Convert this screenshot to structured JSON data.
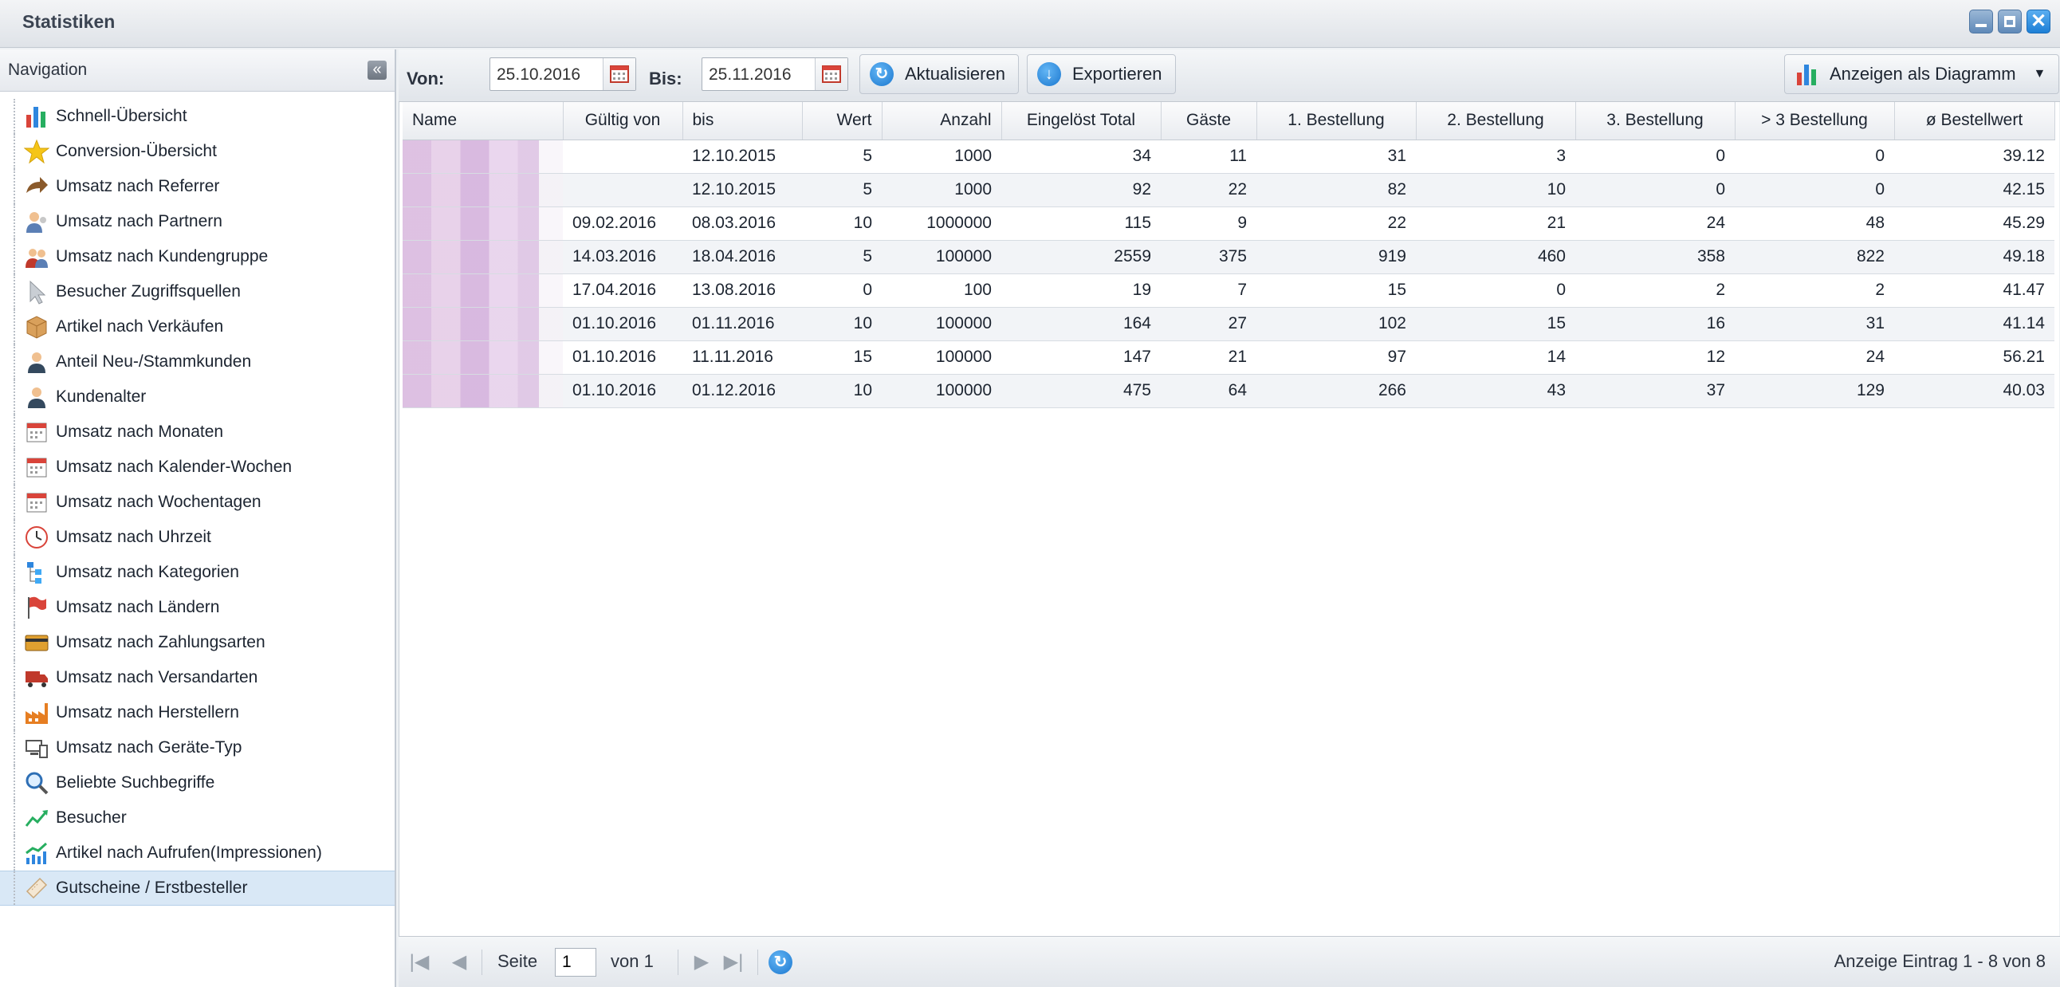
{
  "window": {
    "title": "Statistiken"
  },
  "sidebar": {
    "header": "Navigation",
    "items": [
      {
        "label": "Schnell-Übersicht",
        "icon": "bar-chart-icon"
      },
      {
        "label": "Conversion-Übersicht",
        "icon": "star-icon"
      },
      {
        "label": "Umsatz nach Referrer",
        "icon": "arrow-icon"
      },
      {
        "label": "Umsatz nach Partnern",
        "icon": "user-icon"
      },
      {
        "label": "Umsatz nach Kundengruppe",
        "icon": "users-icon"
      },
      {
        "label": "Besucher Zugriffsquellen",
        "icon": "cursor-icon"
      },
      {
        "label": "Artikel nach Verkäufen",
        "icon": "box-icon"
      },
      {
        "label": "Anteil Neu-/Stammkunden",
        "icon": "person-icon"
      },
      {
        "label": "Kundenalter",
        "icon": "person-icon"
      },
      {
        "label": "Umsatz nach Monaten",
        "icon": "calendar-icon"
      },
      {
        "label": "Umsatz nach Kalender-Wochen",
        "icon": "calendar-icon"
      },
      {
        "label": "Umsatz nach Wochentagen",
        "icon": "calendar-icon"
      },
      {
        "label": "Umsatz nach Uhrzeit",
        "icon": "clock-icon"
      },
      {
        "label": "Umsatz nach Kategorien",
        "icon": "tree-icon"
      },
      {
        "label": "Umsatz nach Ländern",
        "icon": "flag-icon"
      },
      {
        "label": "Umsatz nach Zahlungsarten",
        "icon": "card-icon"
      },
      {
        "label": "Umsatz nach Versandarten",
        "icon": "truck-icon"
      },
      {
        "label": "Umsatz nach Herstellern",
        "icon": "factory-icon"
      },
      {
        "label": "Umsatz nach Geräte-Typ",
        "icon": "devices-icon"
      },
      {
        "label": "Beliebte Suchbegriffe",
        "icon": "magnifier-icon"
      },
      {
        "label": "Besucher",
        "icon": "trend-icon"
      },
      {
        "label": "Artikel nach Aufrufen(Impressionen)",
        "icon": "trend-bars-icon"
      },
      {
        "label": "Gutscheine / Erstbesteller",
        "icon": "ticket-icon"
      }
    ],
    "selected_index": 22
  },
  "toolbar": {
    "von_label": "Von:",
    "von_value": "25.10.2016",
    "bis_label": "Bis:",
    "bis_value": "25.11.2016",
    "refresh_label": "Aktualisieren",
    "export_label": "Exportieren",
    "chart_label": "Anzeigen als Diagramm"
  },
  "table": {
    "columns": [
      "Name",
      "Gültig von",
      "bis",
      "Wert",
      "Anzahl",
      "Eingelöst Total",
      "Gäste",
      "1. Bestellung",
      "2. Bestellung",
      "3. Bestellung",
      "> 3 Bestellung",
      "ø Bestellwert"
    ],
    "rows": [
      [
        "",
        "",
        "12.10.2015",
        "5",
        "1000",
        "34",
        "11",
        "31",
        "3",
        "0",
        "0",
        "39.12"
      ],
      [
        "",
        "",
        "12.10.2015",
        "5",
        "1000",
        "92",
        "22",
        "82",
        "10",
        "0",
        "0",
        "42.15"
      ],
      [
        "",
        "09.02.2016",
        "08.03.2016",
        "10",
        "1000000",
        "115",
        "9",
        "22",
        "21",
        "24",
        "48",
        "45.29"
      ],
      [
        "",
        "14.03.2016",
        "18.04.2016",
        "5",
        "100000",
        "2559",
        "375",
        "919",
        "460",
        "358",
        "822",
        "49.18"
      ],
      [
        "",
        "17.04.2016",
        "13.08.2016",
        "0",
        "100",
        "19",
        "7",
        "15",
        "0",
        "2",
        "2",
        "41.47"
      ],
      [
        "",
        "01.10.2016",
        "01.11.2016",
        "10",
        "100000",
        "164",
        "27",
        "102",
        "15",
        "16",
        "31",
        "41.14"
      ],
      [
        "",
        "01.10.2016",
        "11.11.2016",
        "15",
        "100000",
        "147",
        "21",
        "97",
        "14",
        "12",
        "24",
        "56.21"
      ],
      [
        "",
        "01.10.2016",
        "01.12.2016",
        "10",
        "100000",
        "475",
        "64",
        "266",
        "43",
        "37",
        "129",
        "40.03"
      ]
    ]
  },
  "pager": {
    "page_label": "Seite",
    "page_value": "1",
    "of_label": "von 1",
    "summary": "Anzeige Eintrag 1 - 8 von 8"
  },
  "colors": {
    "accent": "#1b77cf",
    "selected_row": "#d9e8f6",
    "avg_value": "#8a1a8a"
  }
}
